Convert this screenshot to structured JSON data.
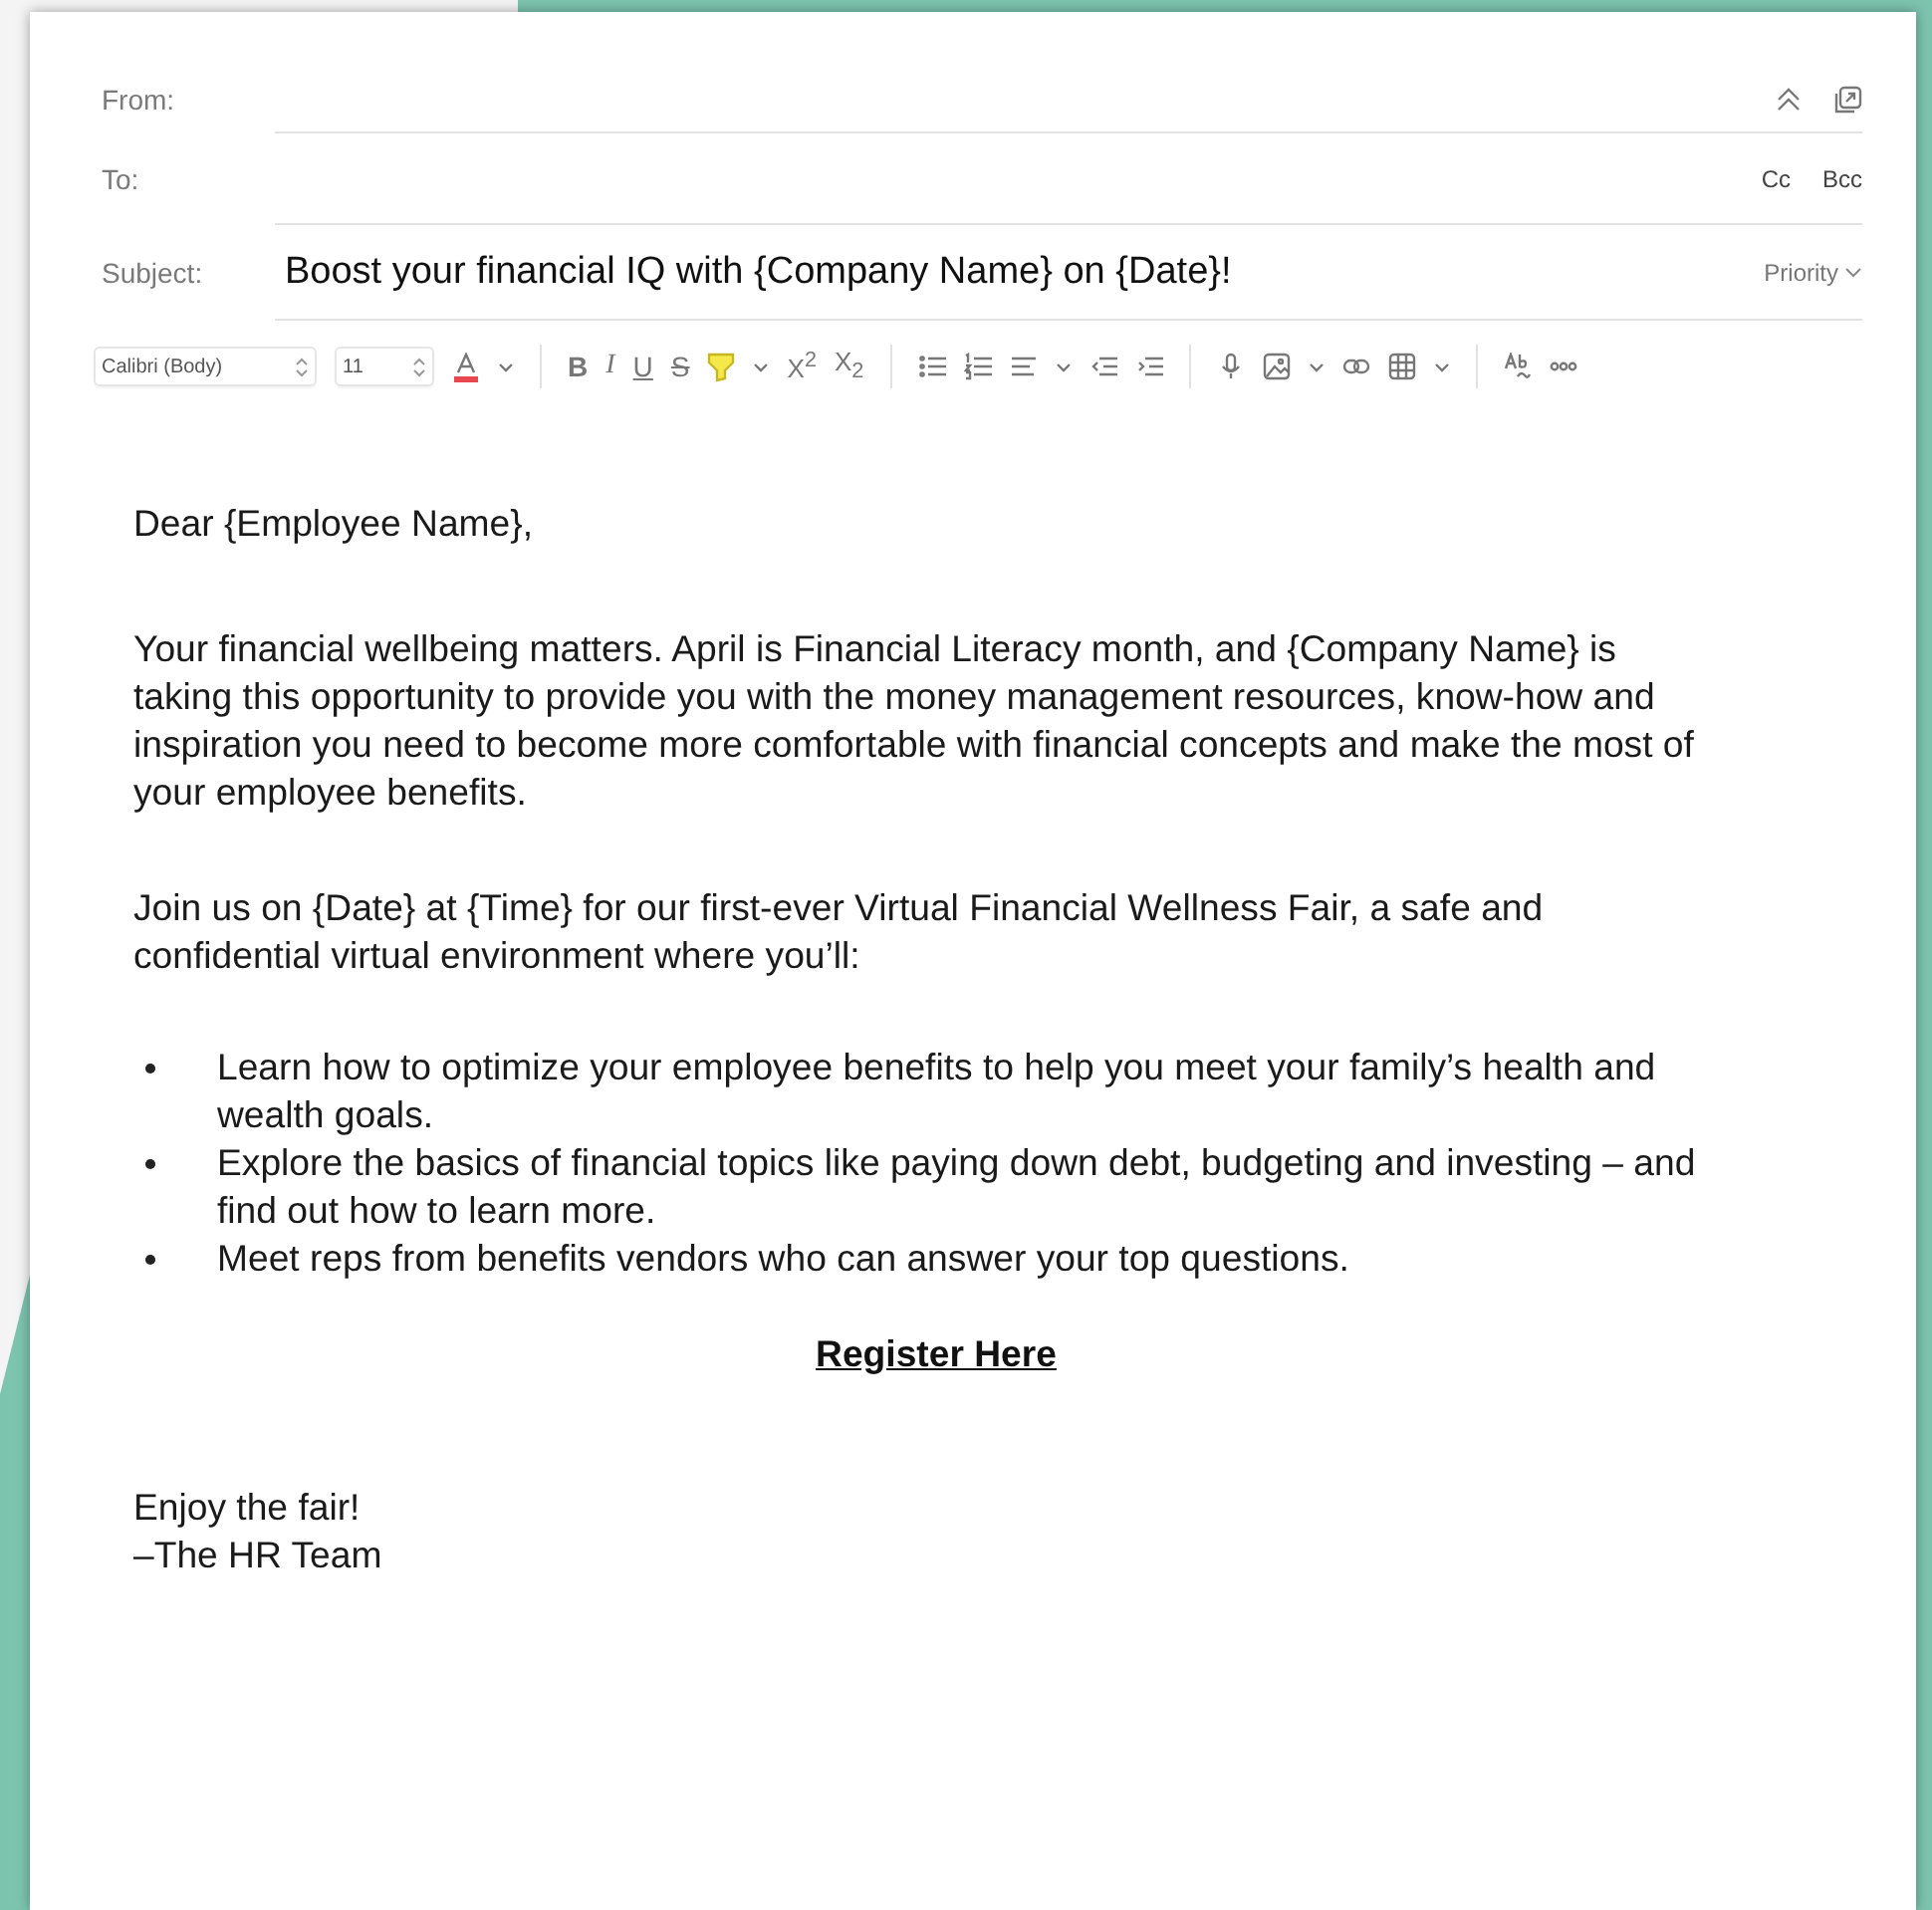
{
  "header": {
    "from": {
      "label": "From:"
    },
    "to": {
      "label": "To:",
      "cc": "Cc",
      "bcc": "Bcc"
    },
    "subject": {
      "label": "Subject:",
      "value": "Boost your financial IQ with {Company Name} on {Date}!",
      "priority": "Priority"
    }
  },
  "toolbar": [
    {
      "kind": "font",
      "label": "Calibri (Body)"
    },
    {
      "kind": "size",
      "label": "11"
    },
    {
      "kind": "fontcolor",
      "color": "#e8474f"
    },
    {
      "kind": "sep"
    },
    {
      "kind": "bold",
      "label": "B"
    },
    {
      "kind": "italic",
      "label": "I"
    },
    {
      "kind": "underline",
      "label": "U"
    },
    {
      "kind": "strike",
      "label": "S"
    },
    {
      "kind": "highlight",
      "color": "#f5e84a"
    },
    {
      "kind": "script",
      "label": "X$^{2}$"
    },
    {
      "kind": "script",
      "label": "X$_{2}$"
    },
    {
      "kind": "sep"
    },
    {
      "kind": "bullets"
    },
    {
      "kind": "numbers"
    },
    {
      "kind": "align"
    },
    {
      "kind": "outdent"
    },
    {
      "kind": "indent"
    },
    {
      "kind": "sep"
    },
    {
      "kind": "mic"
    },
    {
      "kind": "image"
    },
    {
      "kind": "link"
    },
    {
      "kind": "table"
    },
    {
      "kind": "sep"
    },
    {
      "kind": "spelling"
    },
    {
      "kind": "more"
    }
  ],
  "body": [
    {
      "kind": "paragraph",
      "text": "Dear {Employee Name},"
    },
    {
      "kind": "paragraph",
      "text": "Your financial wellbeing matters. April is Financial Literacy month, and {Company Name} is taking this opportunity to provide you with the money management resources, know-how and inspiration you need to become more comfortable with financial concepts and make the most of your employee benefits."
    },
    {
      "kind": "paragraph",
      "text": "Join us on {Date} at {Time} for our first-ever Virtual Financial Wellness Fair, a safe and confidential virtual environment where you’ll:"
    },
    {
      "kind": "bullets",
      "items": [
        "Learn how to optimize your employee benefits to help you meet your family’s health and wealth goals.",
        "Explore the basics of financial topics like paying down debt, budgeting and investing – and find out how to learn more.",
        "Meet reps from benefits vendors who can answer your top questions."
      ]
    },
    {
      "kind": "link",
      "text": "Register Here"
    },
    {
      "kind": "lines",
      "lines": [
        "Enjoy the fair!",
        "–The HR Team"
      ]
    }
  ]
}
